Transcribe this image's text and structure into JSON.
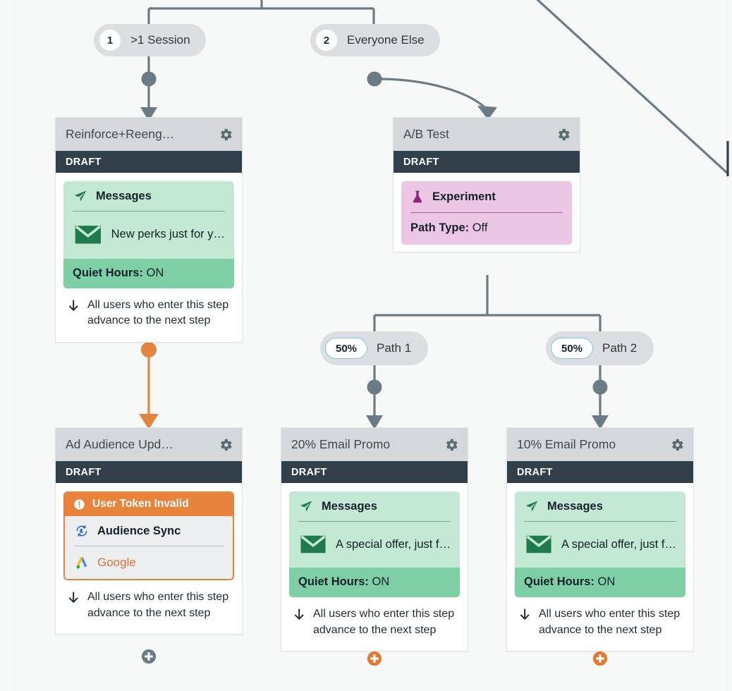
{
  "colors": {
    "canvas_bg": "#f7f8f8",
    "wire": "#6b7b85",
    "wire_orange": "#e2853f",
    "card_header": "#d4d8da",
    "status_bar": "#313f4a",
    "message_green": "#c3e8d4",
    "quiet_green": "#7ecfa6",
    "experiment_purple": "#ecc7e5",
    "error_orange": "#e8833c",
    "pill_grey": "#dcdfe1",
    "pct_border_blue": "#7fc4d8"
  },
  "branches": [
    {
      "number": "1",
      "label": ">1 Session"
    },
    {
      "number": "2",
      "label": "Everyone Else"
    }
  ],
  "split_paths": [
    {
      "percent": "50%",
      "label": "Path 1"
    },
    {
      "percent": "50%",
      "label": "Path 2"
    }
  ],
  "status_label": "DRAFT",
  "advance_note": "All users who enter this step advance to the next step",
  "cards": [
    {
      "title": "Reinforce+Reeng…",
      "status": "DRAFT",
      "type": "messages",
      "block_title": "Messages",
      "block_sub": "New perks just for y…",
      "quiet_label": "Quiet Hours:",
      "quiet_value": "ON",
      "note": "All users who enter this step advance to the next step",
      "gear_icon": "gear-icon",
      "block_icon": "paper-plane-icon",
      "sub_icon": "envelope-icon"
    },
    {
      "title": "A/B Test",
      "status": "DRAFT",
      "type": "experiment",
      "block_title": "Experiment",
      "path_type_label": "Path Type:",
      "path_type_value": "Off",
      "gear_icon": "gear-icon",
      "block_icon": "flask-icon"
    },
    {
      "title": "Ad Audience Upd…",
      "status": "DRAFT",
      "type": "audience",
      "error_label": "User Token Invalid",
      "error_icon": "exclamation-circle-icon",
      "block_title": "Audience Sync",
      "block_icon": "audience-sync-icon",
      "provider": "Google",
      "provider_icon": "google-ads-icon",
      "note": "All users who enter this step advance to the next step",
      "gear_icon": "gear-icon",
      "plus_color": "#6b7b85"
    },
    {
      "title": "20% Email Promo",
      "status": "DRAFT",
      "type": "messages",
      "block_title": "Messages",
      "block_sub": "A special offer, just f…",
      "quiet_label": "Quiet Hours:",
      "quiet_value": "ON",
      "note": "All users who enter this step advance to the next step",
      "gear_icon": "gear-icon",
      "block_icon": "paper-plane-icon",
      "sub_icon": "envelope-icon",
      "plus_color": "#e07b32"
    },
    {
      "title": "10% Email Promo",
      "status": "DRAFT",
      "type": "messages",
      "block_title": "Messages",
      "block_sub": "A special offer, just f…",
      "quiet_label": "Quiet Hours:",
      "quiet_value": "ON",
      "note": "All users who enter this step advance to the next step",
      "gear_icon": "gear-icon",
      "block_icon": "paper-plane-icon",
      "sub_icon": "envelope-icon",
      "plus_color": "#e07b32"
    }
  ]
}
